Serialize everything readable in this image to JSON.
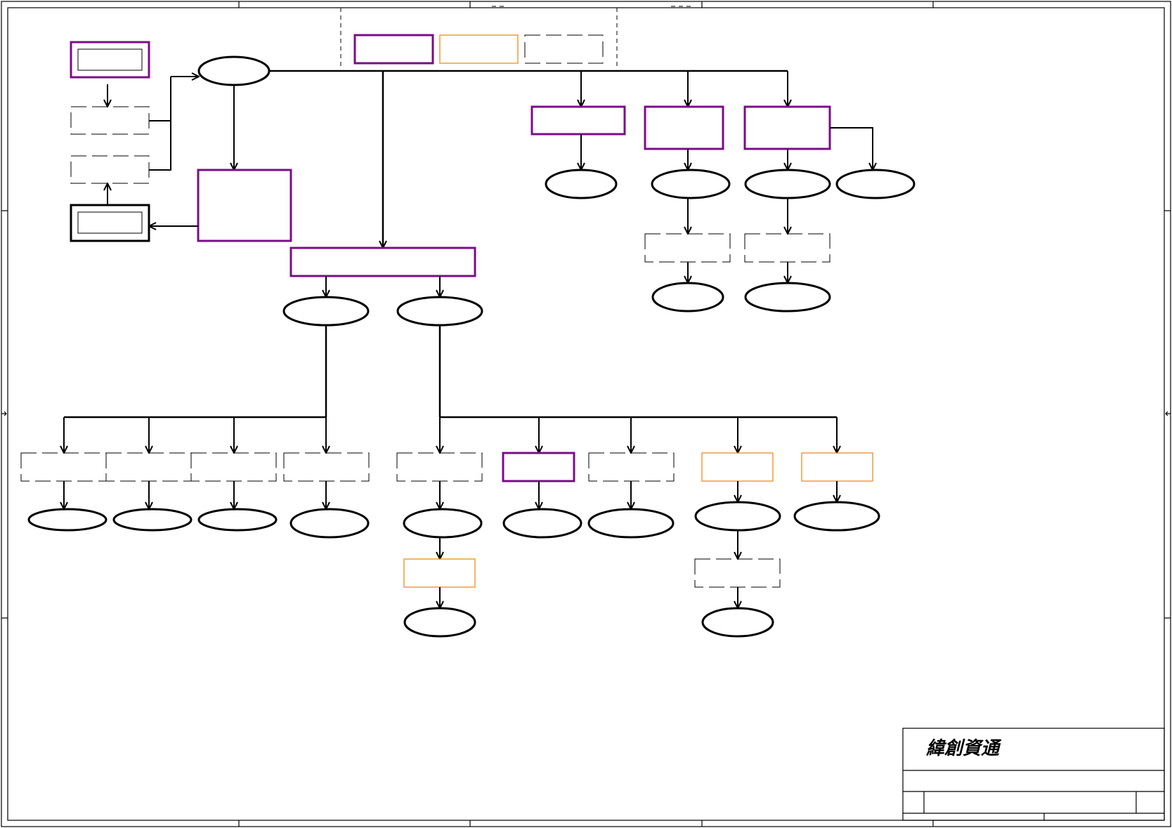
{
  "title_block": {
    "company": "緯創資通"
  },
  "colors": {
    "border": "#000000",
    "purple": "#7B0C8A",
    "orange": "#F29B3A",
    "dashed": "#000000"
  },
  "legend": [
    {
      "name": "legend-purple-box",
      "style": "purple"
    },
    {
      "name": "legend-orange-box",
      "style": "orange"
    },
    {
      "name": "legend-dashed-box",
      "style": "dashed"
    }
  ]
}
